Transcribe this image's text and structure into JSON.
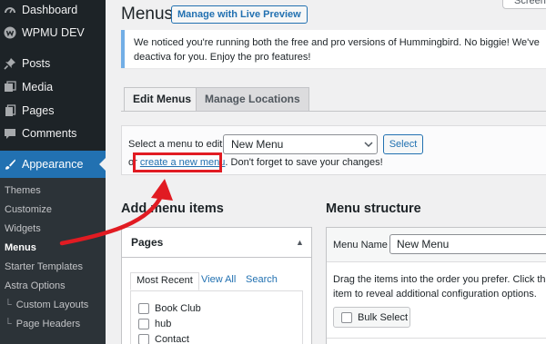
{
  "sidebar": {
    "items": [
      {
        "label": "Dashboard",
        "icon": "dashboard-icon"
      },
      {
        "label": "WPMU DEV",
        "icon": "wpmu-dev-icon"
      },
      {
        "label": "Posts",
        "icon": "pushpin-icon"
      },
      {
        "label": "Media",
        "icon": "media-icon"
      },
      {
        "label": "Pages",
        "icon": "pages-icon"
      },
      {
        "label": "Comments",
        "icon": "comments-icon"
      },
      {
        "label": "Appearance",
        "icon": "paintbrush-icon"
      }
    ],
    "submenu": [
      {
        "label": "Themes"
      },
      {
        "label": "Customize"
      },
      {
        "label": "Widgets"
      },
      {
        "label": "Menus"
      },
      {
        "label": "Starter Templates"
      },
      {
        "label": "Astra Options"
      },
      {
        "label": "Custom Layouts"
      },
      {
        "label": "Page Headers"
      }
    ]
  },
  "header": {
    "title": "Menus",
    "live_preview_label": "Manage with Live Preview",
    "screen_options_label": "Screen"
  },
  "notice": {
    "text": "We noticed you're running both the free and pro versions of Hummingbird. No biggie! We've deactiva for you. Enjoy the pro features!"
  },
  "tabs": [
    {
      "label": "Edit Menus",
      "active": true
    },
    {
      "label": "Manage Locations",
      "active": false
    }
  ],
  "manage": {
    "select_label": "Select a menu to edit:",
    "selected_menu": "New Menu",
    "select_button": "Select",
    "or_prefix": "or",
    "create_link": "create a new menu",
    "or_suffix": ". Don't forget to save your changes!"
  },
  "add_items": {
    "heading": "Add menu items",
    "panel_title": "Pages",
    "tabs": [
      "Most Recent",
      "View All",
      "Search"
    ],
    "pages": [
      "Book Club",
      "hub",
      "Contact"
    ]
  },
  "structure": {
    "heading": "Menu structure",
    "menu_name_label": "Menu Name",
    "menu_name_value": "New Menu",
    "drag_text_line1": "Drag the items into the order you prefer. Click the ar",
    "drag_text_line2": "item to reveal additional configuration options.",
    "bulk_select_label": "Bulk Select"
  },
  "colors": {
    "sidebar_bg": "#1d2327",
    "accent": "#2271b1",
    "highlight": "#e11b22"
  }
}
